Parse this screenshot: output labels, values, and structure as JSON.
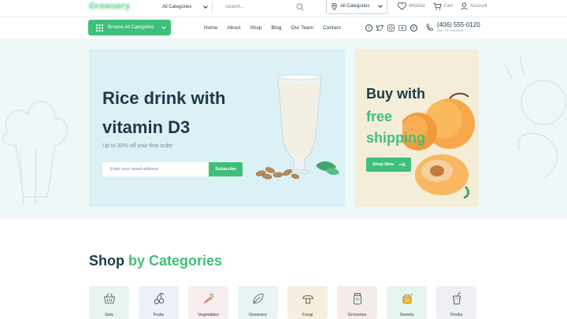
{
  "header": {
    "logo_text": "Greenery",
    "category_select": "All Categories",
    "search_placeholder": "Search...",
    "location_select": "All Categories",
    "wishlist": "Wishlist",
    "cart": "Cart",
    "account": "Account"
  },
  "nav": {
    "browse_label": "Browse All Categories",
    "items": [
      "Home",
      "About",
      "Shop",
      "Blog",
      "Our Team",
      "Contact"
    ],
    "social_icons": [
      "facebook-icon",
      "twitter-icon",
      "instagram-icon",
      "youtube-icon",
      "whatsapp-icon"
    ],
    "phone": "(406) 555-0120",
    "hours": "Mon - Fri: 9:00-20:00"
  },
  "hero": {
    "title": "Rice drink with vitamin D3",
    "subtitle": "Up to 30% off your first order",
    "email_placeholder": "Enter your email address",
    "subscribe_label": "Subscribe",
    "side_title_line1": "Buy with",
    "side_title_line2": "free shipping",
    "shop_now_label": "Shop Now"
  },
  "categories_section": {
    "title_part1": "Shop",
    "title_part2": "by Categories",
    "items": [
      {
        "label": "Sets",
        "icon": "basket-icon",
        "bg": "#e6f5ef"
      },
      {
        "label": "Fruits",
        "icon": "cherry-icon",
        "bg": "#eef0f8"
      },
      {
        "label": "Vegetables",
        "icon": "carrot-icon",
        "bg": "#f8eef0"
      },
      {
        "label": "Greenery",
        "icon": "leaf-icon",
        "bg": "#e8f3f6"
      },
      {
        "label": "Fungi",
        "icon": "mushroom-icon",
        "bg": "#f5efdf"
      },
      {
        "label": "Groceries",
        "icon": "jar-icon",
        "bg": "#f6ecec"
      },
      {
        "label": "Sweets",
        "icon": "honey-icon",
        "bg": "#e6f5ef"
      },
      {
        "label": "Drinks",
        "icon": "drink-icon",
        "bg": "#eef0f5"
      }
    ]
  },
  "colors": {
    "accent": "#3ec07a",
    "dark": "#1d3a4a",
    "muted": "#7c8a94",
    "hero_bg": "#eef8f9",
    "main_banner_bg": "#dbf1f6",
    "side_banner_bg": "#f4edd8"
  }
}
